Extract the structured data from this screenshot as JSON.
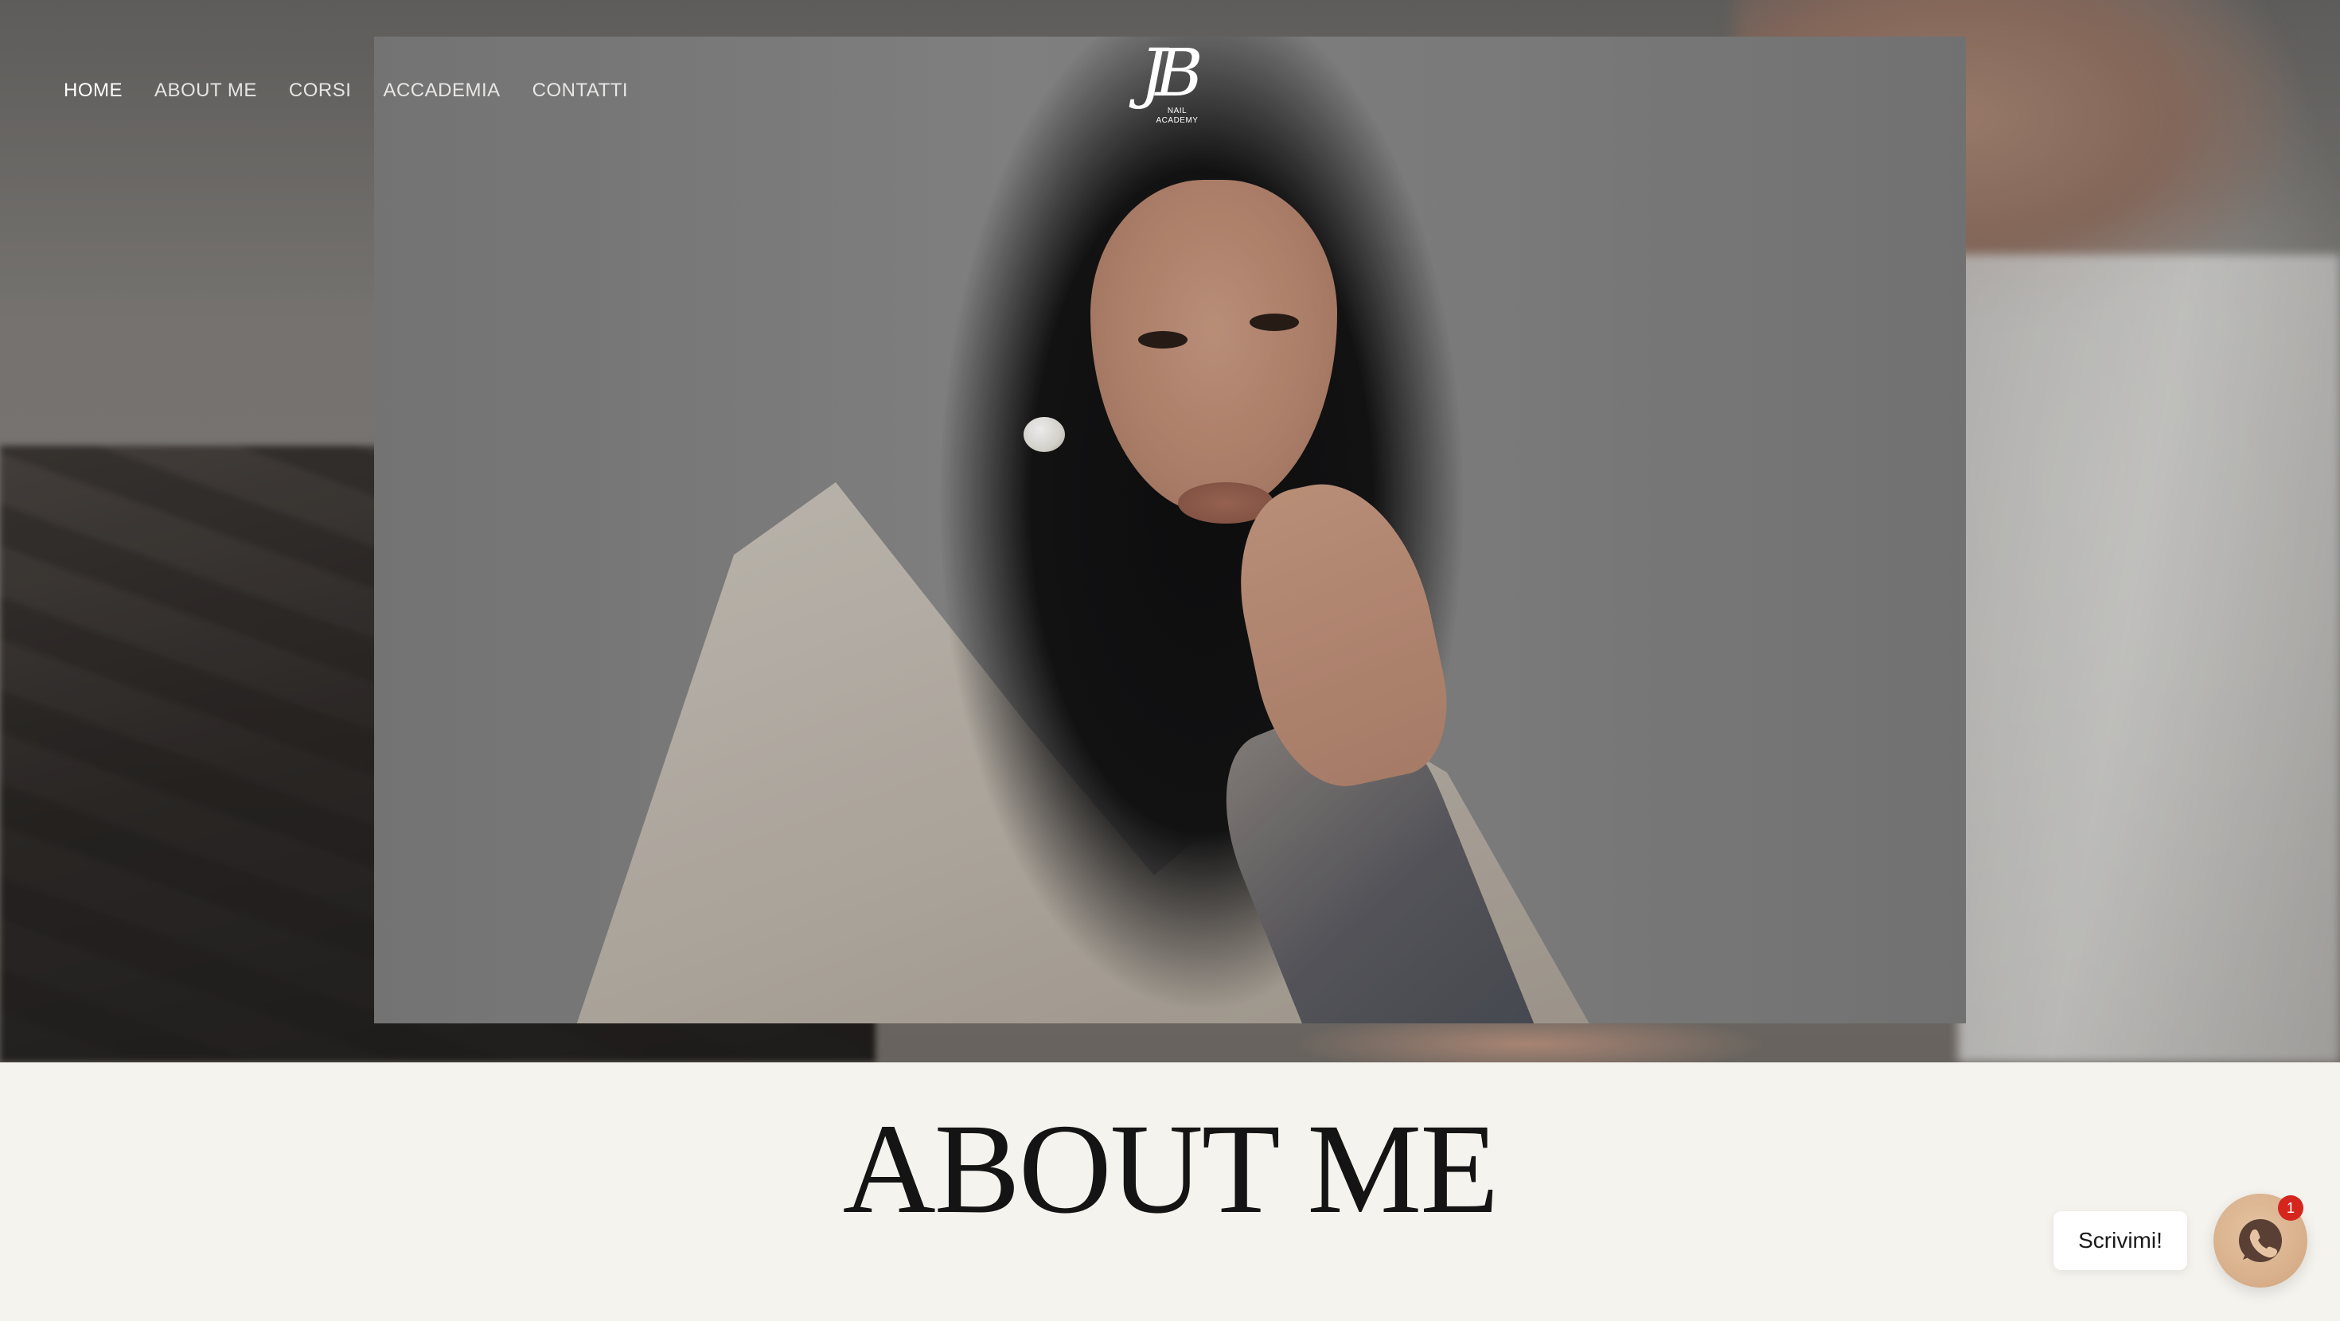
{
  "nav": {
    "items": [
      {
        "label": "HOME",
        "active": true
      },
      {
        "label": "ABOUT ME",
        "active": false
      },
      {
        "label": "CORSI",
        "active": false
      },
      {
        "label": "ACCADEMIA",
        "active": false
      },
      {
        "label": "CONTATTI",
        "active": false
      }
    ]
  },
  "logo": {
    "mark": "JB",
    "line1": "NAIL",
    "line2": "ACADEMY"
  },
  "about": {
    "title": "ABOUT ME"
  },
  "chat": {
    "bubble_label": "Scrivimi!",
    "badge_count": "1",
    "icon": "whatsapp-icon"
  },
  "colors": {
    "page_background": "#f5f3ee",
    "chat_button": "#d7ae89",
    "badge": "#d5261e"
  }
}
